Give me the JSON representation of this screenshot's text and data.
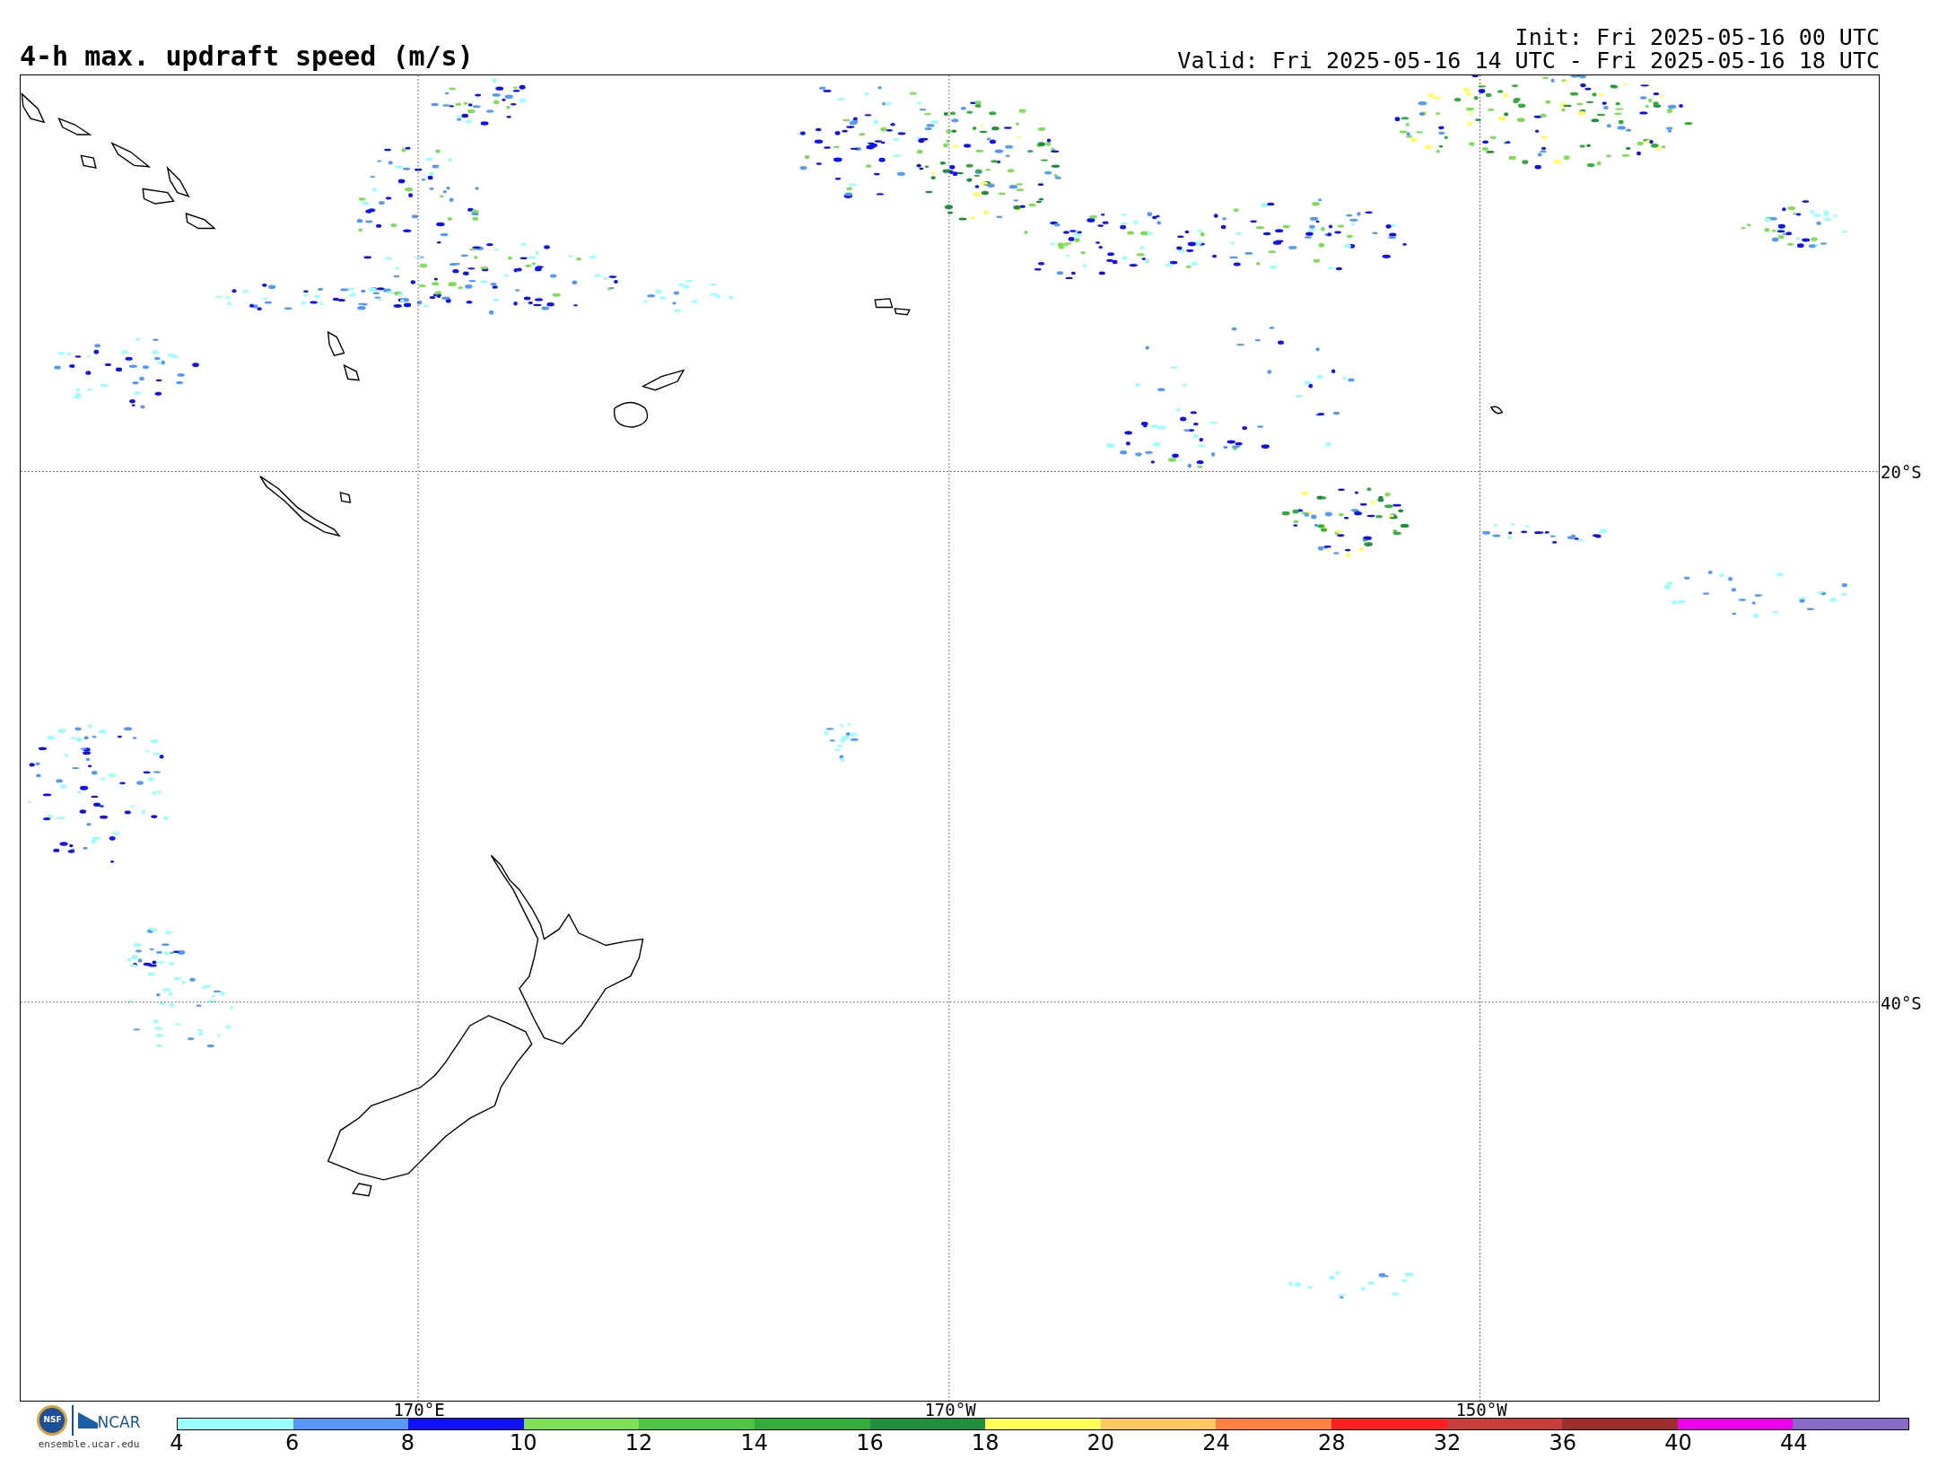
{
  "title": "4-h max. updraft speed (m/s)",
  "init": "Init: Fri 2025-05-16 00 UTC",
  "valid": "Valid: Fri 2025-05-16 14 UTC - Fri 2025-05-16 18 UTC",
  "map": {
    "longitude_labels": [
      "170°E",
      "170°W",
      "150°W"
    ],
    "latitude_labels": [
      "20°S",
      "40°S"
    ]
  },
  "logo": {
    "seal": "NSF",
    "name": "NCAR",
    "url": "ensemble.ucar.edu"
  },
  "colorbar": [
    {
      "label": "4",
      "color": "#99ffff"
    },
    {
      "label": "6",
      "color": "#5599f8"
    },
    {
      "label": "8",
      "color": "#1010f8"
    },
    {
      "label": "10",
      "color": "#7ddf53"
    },
    {
      "label": "12",
      "color": "#4dc645"
    },
    {
      "label": "14",
      "color": "#32ad3b"
    },
    {
      "label": "16",
      "color": "#1f8f3c"
    },
    {
      "label": "18",
      "color": "#ffff55"
    },
    {
      "label": "20",
      "color": "#ffc85f"
    },
    {
      "label": "24",
      "color": "#ff8040"
    },
    {
      "label": "28",
      "color": "#ff2020"
    },
    {
      "label": "32",
      "color": "#cb3c3c"
    },
    {
      "label": "36",
      "color": "#a02c2c"
    },
    {
      "label": "40",
      "color": "#ee00ee"
    },
    {
      "label": "44",
      "color": "#8a68c8"
    }
  ]
}
